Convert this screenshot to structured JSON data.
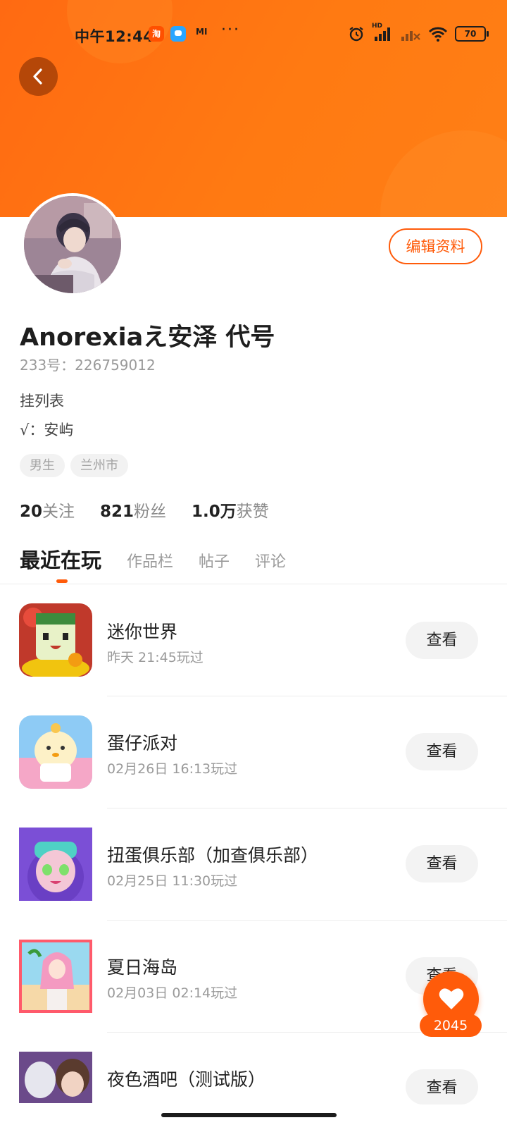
{
  "status_bar": {
    "time": "中午12:44",
    "taobao_glyph": "淘",
    "mi_label": "MI",
    "more": "···",
    "network": "HD",
    "battery": "70"
  },
  "profile": {
    "edit_button": "编辑资料",
    "name": "Anorexiaえ安泽 代号",
    "uid": "233号：226759012",
    "bio_line1": "挂列表",
    "bio_line2": "√：安屿",
    "tags": [
      "男生",
      "兰州市"
    ]
  },
  "stats": [
    {
      "value": "20",
      "label": "关注"
    },
    {
      "value": "821",
      "label": "粉丝"
    },
    {
      "value": "1.0万",
      "label": "获赞"
    }
  ],
  "tabs": [
    {
      "label": "最近在玩",
      "active": true
    },
    {
      "label": "作品栏",
      "active": false
    },
    {
      "label": "帖子",
      "active": false
    },
    {
      "label": "评论",
      "active": false
    }
  ],
  "games": [
    {
      "title": "迷你世界",
      "time": "昨天 21:45玩过",
      "button": "查看",
      "icon": "mini-world-icon"
    },
    {
      "title": "蛋仔派对",
      "time": "02月26日 16:13玩过",
      "button": "查看",
      "icon": "egg-party-icon"
    },
    {
      "title": "扭蛋俱乐部（加查俱乐部）",
      "time": "02月25日 11:30玩过",
      "button": "查看",
      "icon": "gacha-club-icon"
    },
    {
      "title": "夏日海岛",
      "time": "02月03日 02:14玩过",
      "button": "查看",
      "icon": "summer-island-icon"
    },
    {
      "title": "夜色酒吧（测试版）",
      "time": "",
      "button": "查看",
      "icon": "night-bar-icon"
    }
  ],
  "fab": {
    "count": "2045",
    "icon": "heart-icon"
  },
  "colors": {
    "accent": "#ff5b0a",
    "header": "#ff7412"
  }
}
